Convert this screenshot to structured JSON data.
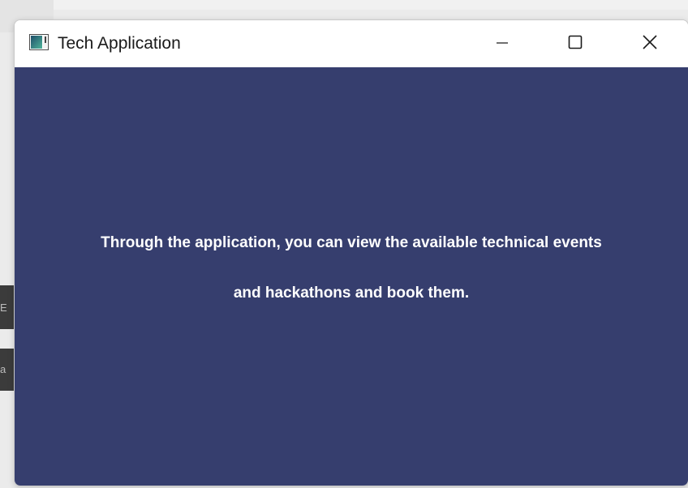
{
  "window": {
    "title": "Tech Application",
    "icon": "app-window-icon",
    "controls": {
      "minimize_icon": "minimize-icon",
      "maximize_icon": "maximize-icon",
      "close_icon": "close-icon"
    }
  },
  "content": {
    "background_color": "#363e6e",
    "text_color": "#ffffff",
    "message_line1": "Through the application, you can view the available technical events",
    "message_line2": "and hackathons and book them."
  },
  "background": {
    "glyph1": "E",
    "glyph2": "a"
  }
}
